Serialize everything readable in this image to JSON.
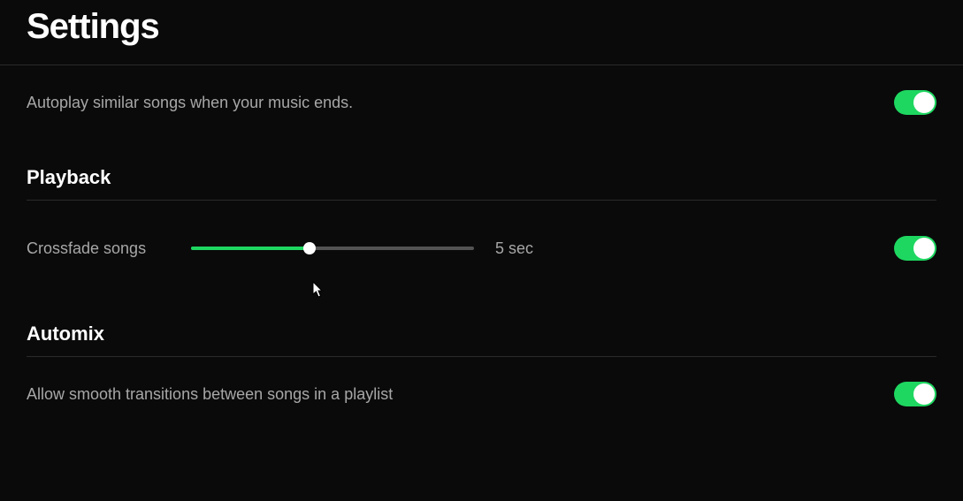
{
  "page": {
    "title": "Settings"
  },
  "autoplay": {
    "label": "Autoplay similar songs when your music ends.",
    "enabled": true
  },
  "playback": {
    "header": "Playback",
    "crossfade": {
      "label": "Crossfade songs",
      "value_text": "5 sec",
      "value": 5,
      "min": 0,
      "max": 12,
      "enabled": true
    }
  },
  "automix": {
    "header": "Automix",
    "label": "Allow smooth transitions between songs in a playlist",
    "enabled": true
  },
  "colors": {
    "accent": "#1ed760",
    "background": "#0a0a0a",
    "text_primary": "#ffffff",
    "text_secondary": "#a7a7a7"
  }
}
